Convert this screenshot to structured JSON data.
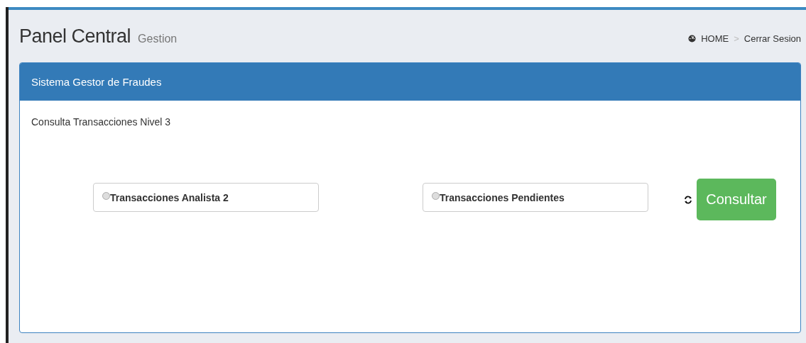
{
  "header": {
    "title": "Panel Central",
    "subtitle": "Gestion"
  },
  "breadcrumb": {
    "items": [
      {
        "label": "HOME"
      },
      {
        "label": "Cerrar Sesion"
      }
    ],
    "separator": ">"
  },
  "panel": {
    "title": "Sistema Gestor de Fraudes",
    "heading": "Consulta Transacciones Nivel 3",
    "options": [
      {
        "label": "Transacciones Analista 2",
        "selected": false
      },
      {
        "label": "Transacciones Pendientes",
        "selected": false
      }
    ],
    "button": "Consultar"
  }
}
